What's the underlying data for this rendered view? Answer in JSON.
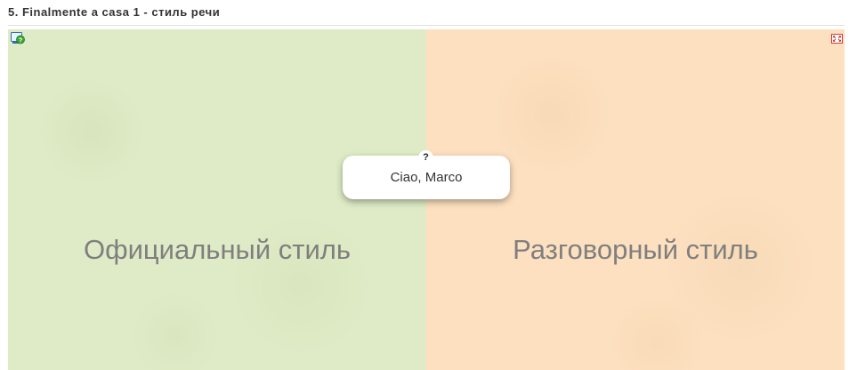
{
  "header": {
    "title": "5. Finalmente a casa 1 - стиль речи"
  },
  "board": {
    "zones": [
      {
        "label": "Официальный стиль",
        "color": "#dfebc6"
      },
      {
        "label": "Разговорный стиль",
        "color": "#fde0c0"
      }
    ],
    "card": {
      "text": "Ciao, Marco",
      "hint": "?"
    },
    "icons": {
      "help": "help-question-icon",
      "fullscreen": "fullscreen-icon"
    }
  }
}
